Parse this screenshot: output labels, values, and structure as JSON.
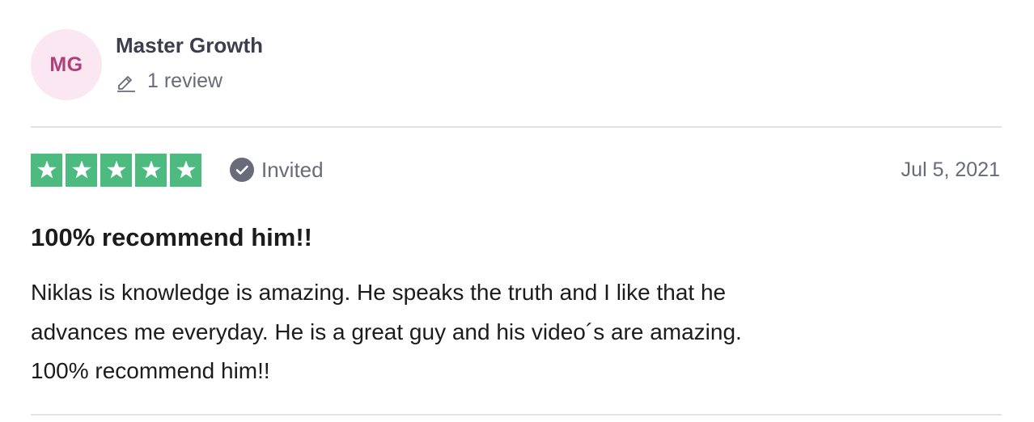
{
  "reviewer": {
    "initials": "MG",
    "name": "Master Growth",
    "review_count": "1 review",
    "avatar_bg": "#fbe7f1",
    "avatar_fg": "#b0407a"
  },
  "review": {
    "rating": 5,
    "max_rating": 5,
    "star_color": "#4dbb7f",
    "invited_label": "Invited",
    "date": "Jul 5, 2021",
    "title": "100% recommend him!!",
    "body_lines": [
      "Niklas is knowledge is amazing. He speaks the truth and I like that he",
      "advances me everyday. He is a great guy and his video´s are amazing.",
      "100% recommend him!!"
    ]
  },
  "icons": {
    "pencil": "pencil-icon",
    "invited": "check-circle-icon",
    "star": "star-icon"
  }
}
